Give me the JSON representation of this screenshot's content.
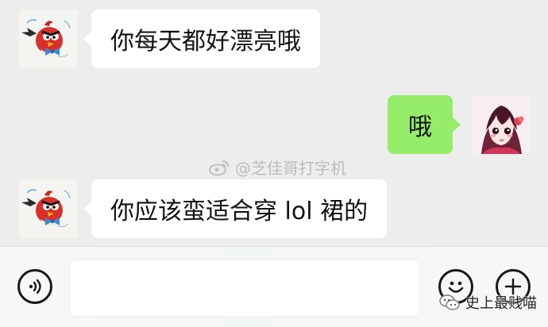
{
  "chat": {
    "messages": [
      {
        "side": "left",
        "text": "你每天都好漂亮哦"
      },
      {
        "side": "right",
        "text": "哦"
      },
      {
        "side": "left",
        "text": "你应该蛮适合穿 lol 裙的"
      }
    ]
  },
  "watermark": {
    "text": "@芝佳哥打字机",
    "icon": "weibo-icon"
  },
  "input_bar": {
    "value": "",
    "placeholder": "",
    "icons": [
      "voice-icon",
      "emoji-icon",
      "plus-icon"
    ]
  },
  "source_badge": {
    "text": "史上最贱喵",
    "icon": "wechat-official-account-icon"
  },
  "colors": {
    "chat_background": "#ededed",
    "incoming_bubble": "#ffffff",
    "outgoing_bubble": "#95ec69",
    "input_bar": "#f7f7f7"
  }
}
